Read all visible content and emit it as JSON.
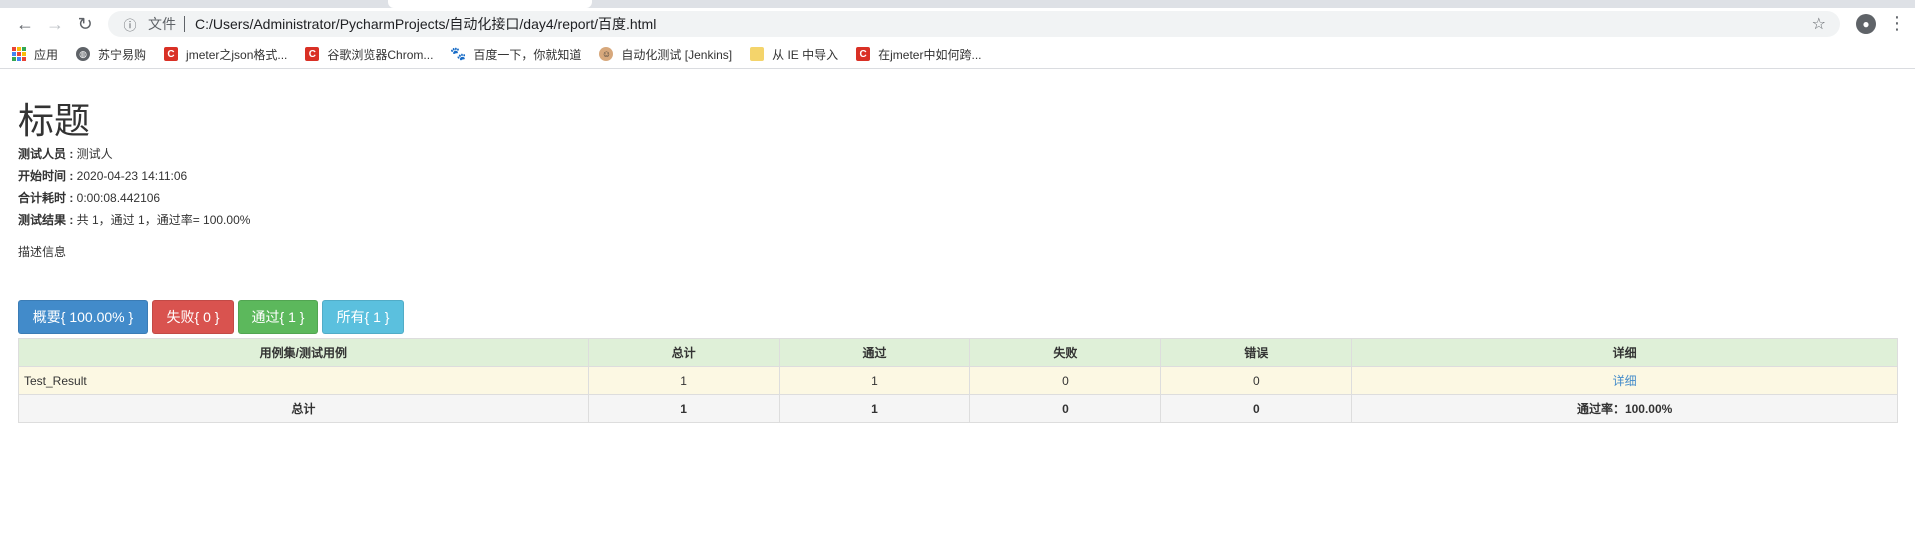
{
  "browser": {
    "address": {
      "scheme_label": "文件",
      "url": "C:/Users/Administrator/PycharmProjects/自动化接口/day4/report/百度.html"
    },
    "bookmarks": [
      {
        "label": "应用",
        "icon": "apps-icon"
      },
      {
        "label": "苏宁易购",
        "icon": "globe-icon"
      },
      {
        "label": "jmeter之json格式...",
        "icon": "csdn-icon"
      },
      {
        "label": "谷歌浏览器Chrom...",
        "icon": "csdn-icon"
      },
      {
        "label": "百度一下，你就知道",
        "icon": "baidu-paw-icon"
      },
      {
        "label": "自动化测试 [Jenkins]",
        "icon": "jenkins-icon"
      },
      {
        "label": "从 IE 中导入",
        "icon": "folder-icon"
      },
      {
        "label": "在jmeter中如何跨...",
        "icon": "csdn-icon"
      }
    ]
  },
  "report": {
    "title": "标题",
    "tester_label": "测试人员 :",
    "tester_value": " 测试人",
    "start_label": "开始时间 :",
    "start_value": " 2020-04-23 14:11:06",
    "duration_label": "合计耗时 :",
    "duration_value": " 0:00:08.442106",
    "result_label": "测试结果 :",
    "result_value": " 共 1，通过 1，通过率= 100.00%",
    "description": "描述信息"
  },
  "buttons": {
    "summary": "概要{ 100.00% }",
    "failed": "失败{ 0 }",
    "passed": "通过{ 1 }",
    "all": "所有{ 1 }"
  },
  "table": {
    "headers": [
      "用例集/测试用例",
      "总计",
      "通过",
      "失败",
      "错误",
      "详细"
    ],
    "case_row": {
      "name": "Test_Result",
      "total": "1",
      "pass": "1",
      "fail": "0",
      "error": "0",
      "detail": "详细"
    },
    "total_row": {
      "name": "总计",
      "total": "1",
      "pass": "1",
      "fail": "0",
      "error": "0",
      "rate": "通过率：100.00%"
    }
  },
  "colors": {
    "primary": "#428bca",
    "danger": "#d9534f",
    "success": "#5cb85c",
    "info": "#5bc0de",
    "header_bg": "#dff0d8",
    "case_row_bg": "#fcf8e3"
  }
}
